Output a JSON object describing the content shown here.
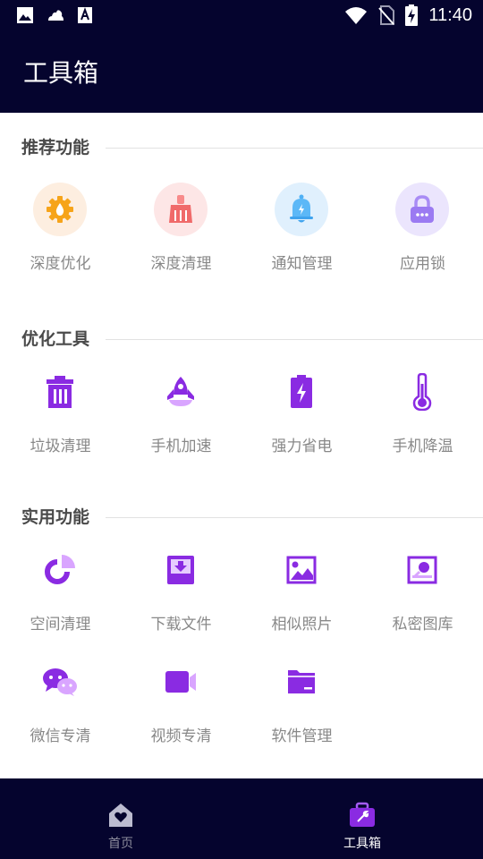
{
  "status_bar": {
    "time": "11:40",
    "icons": [
      "image-icon",
      "cloud-icon",
      "a-icon",
      "wifi-icon",
      "no-sim-icon",
      "battery-charging-icon"
    ]
  },
  "app_bar": {
    "title": "工具箱"
  },
  "sections": [
    {
      "title": "推荐功能",
      "items": [
        {
          "label": "深度优化",
          "icon": "gear-drop-icon"
        },
        {
          "label": "深度清理",
          "icon": "broom-icon"
        },
        {
          "label": "通知管理",
          "icon": "bell-icon"
        },
        {
          "label": "应用锁",
          "icon": "lock-icon"
        }
      ]
    },
    {
      "title": "优化工具",
      "items": [
        {
          "label": "垃圾清理",
          "icon": "trash-icon"
        },
        {
          "label": "手机加速",
          "icon": "rocket-icon"
        },
        {
          "label": "强力省电",
          "icon": "battery-bolt-icon"
        },
        {
          "label": "手机降温",
          "icon": "thermometer-icon"
        }
      ]
    },
    {
      "title": "实用功能",
      "items": [
        {
          "label": "空间清理",
          "icon": "pie-chart-icon"
        },
        {
          "label": "下载文件",
          "icon": "download-icon"
        },
        {
          "label": "相似照片",
          "icon": "photo-icon"
        },
        {
          "label": "私密图库",
          "icon": "private-gallery-icon"
        },
        {
          "label": "微信专清",
          "icon": "wechat-icon"
        },
        {
          "label": "视频专清",
          "icon": "video-icon"
        },
        {
          "label": "软件管理",
          "icon": "folder-icon"
        }
      ]
    }
  ],
  "bottom_nav": [
    {
      "label": "首页",
      "icon": "home-heart-icon",
      "active": false
    },
    {
      "label": "工具箱",
      "icon": "toolbox-icon",
      "active": true
    }
  ],
  "colors": {
    "dark_bg": "#05042e",
    "accent_purple": "#8a2be2",
    "label_gray": "#888888",
    "nav_active": "#ffffff",
    "nav_inactive": "#8c8c9c"
  }
}
